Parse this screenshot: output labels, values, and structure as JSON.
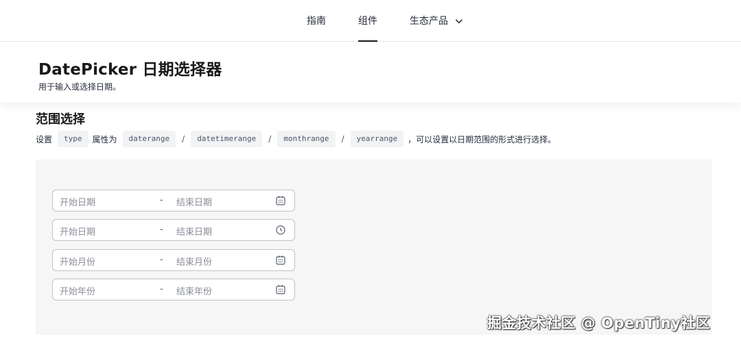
{
  "nav": {
    "items": [
      {
        "label": "指南"
      },
      {
        "label": "组件"
      },
      {
        "label": "生态产品"
      }
    ],
    "active_index": 1,
    "dropdown_icon": "chevron-down-icon"
  },
  "header": {
    "title": "DatePicker 日期选择器",
    "description": "用于输入或选择日期。"
  },
  "section": {
    "title": "范围选择",
    "desc_prefix": "设置",
    "code_type": "type",
    "desc_mid": "属性为",
    "code_values": [
      "daterange",
      "datetimerange",
      "monthrange",
      "yearrange"
    ],
    "separator": "/",
    "desc_suffix": "，可以设置以日期范围的形式进行选择。"
  },
  "pickers": [
    {
      "start_placeholder": "开始日期",
      "separator": "-",
      "end_placeholder": "结束日期",
      "icon": "calendar-icon"
    },
    {
      "start_placeholder": "开始日期",
      "separator": "-",
      "end_placeholder": "结束日期",
      "icon": "clock-icon"
    },
    {
      "start_placeholder": "开始月份",
      "separator": "-",
      "end_placeholder": "结束月份",
      "icon": "calendar-icon"
    },
    {
      "start_placeholder": "开始年份",
      "separator": "-",
      "end_placeholder": "结束年份",
      "icon": "calendar-icon"
    }
  ],
  "watermark": "掘金技术社区 @ OpenTiny社区",
  "colors": {
    "text": "#252b3a",
    "placeholder": "#8a8e99",
    "border": "#c2c2c2",
    "demo_bg": "#f6f6f6",
    "code_bg": "#f2f3f5"
  }
}
